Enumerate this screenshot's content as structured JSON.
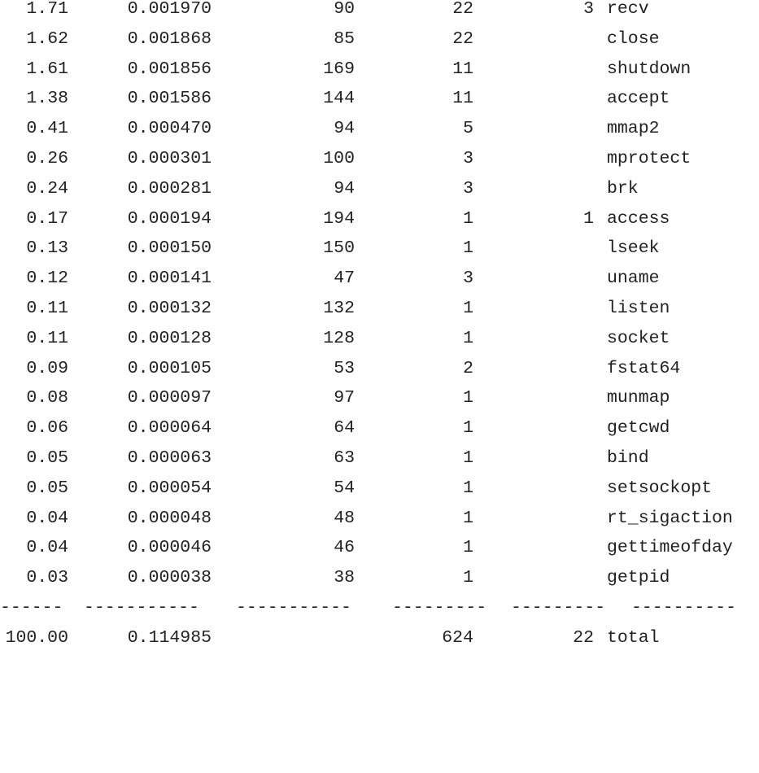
{
  "rows": [
    {
      "pct_time": "1.71",
      "seconds": "0.001970",
      "usecs_call": "90",
      "calls": "22",
      "errors": "3",
      "syscall": "recv"
    },
    {
      "pct_time": "1.62",
      "seconds": "0.001868",
      "usecs_call": "85",
      "calls": "22",
      "errors": "",
      "syscall": "close"
    },
    {
      "pct_time": "1.61",
      "seconds": "0.001856",
      "usecs_call": "169",
      "calls": "11",
      "errors": "",
      "syscall": "shutdown"
    },
    {
      "pct_time": "1.38",
      "seconds": "0.001586",
      "usecs_call": "144",
      "calls": "11",
      "errors": "",
      "syscall": "accept"
    },
    {
      "pct_time": "0.41",
      "seconds": "0.000470",
      "usecs_call": "94",
      "calls": "5",
      "errors": "",
      "syscall": "mmap2"
    },
    {
      "pct_time": "0.26",
      "seconds": "0.000301",
      "usecs_call": "100",
      "calls": "3",
      "errors": "",
      "syscall": "mprotect"
    },
    {
      "pct_time": "0.24",
      "seconds": "0.000281",
      "usecs_call": "94",
      "calls": "3",
      "errors": "",
      "syscall": "brk"
    },
    {
      "pct_time": "0.17",
      "seconds": "0.000194",
      "usecs_call": "194",
      "calls": "1",
      "errors": "1",
      "syscall": "access"
    },
    {
      "pct_time": "0.13",
      "seconds": "0.000150",
      "usecs_call": "150",
      "calls": "1",
      "errors": "",
      "syscall": "lseek"
    },
    {
      "pct_time": "0.12",
      "seconds": "0.000141",
      "usecs_call": "47",
      "calls": "3",
      "errors": "",
      "syscall": "uname"
    },
    {
      "pct_time": "0.11",
      "seconds": "0.000132",
      "usecs_call": "132",
      "calls": "1",
      "errors": "",
      "syscall": "listen"
    },
    {
      "pct_time": "0.11",
      "seconds": "0.000128",
      "usecs_call": "128",
      "calls": "1",
      "errors": "",
      "syscall": "socket"
    },
    {
      "pct_time": "0.09",
      "seconds": "0.000105",
      "usecs_call": "53",
      "calls": "2",
      "errors": "",
      "syscall": "fstat64"
    },
    {
      "pct_time": "0.08",
      "seconds": "0.000097",
      "usecs_call": "97",
      "calls": "1",
      "errors": "",
      "syscall": "munmap"
    },
    {
      "pct_time": "0.06",
      "seconds": "0.000064",
      "usecs_call": "64",
      "calls": "1",
      "errors": "",
      "syscall": "getcwd"
    },
    {
      "pct_time": "0.05",
      "seconds": "0.000063",
      "usecs_call": "63",
      "calls": "1",
      "errors": "",
      "syscall": "bind"
    },
    {
      "pct_time": "0.05",
      "seconds": "0.000054",
      "usecs_call": "54",
      "calls": "1",
      "errors": "",
      "syscall": "setsockopt"
    },
    {
      "pct_time": "0.04",
      "seconds": "0.000048",
      "usecs_call": "48",
      "calls": "1",
      "errors": "",
      "syscall": "rt_sigaction"
    },
    {
      "pct_time": "0.04",
      "seconds": "0.000046",
      "usecs_call": "46",
      "calls": "1",
      "errors": "",
      "syscall": "gettimeofday"
    },
    {
      "pct_time": "0.03",
      "seconds": "0.000038",
      "usecs_call": "38",
      "calls": "1",
      "errors": "",
      "syscall": "getpid"
    }
  ],
  "separator": [
    "------",
    "-----------",
    "-----------",
    "---------",
    "---------",
    "----------"
  ],
  "total": {
    "pct_time": "100.00",
    "seconds": "0.114985",
    "usecs_call": "",
    "calls": "624",
    "errors": "22",
    "syscall": "total"
  }
}
